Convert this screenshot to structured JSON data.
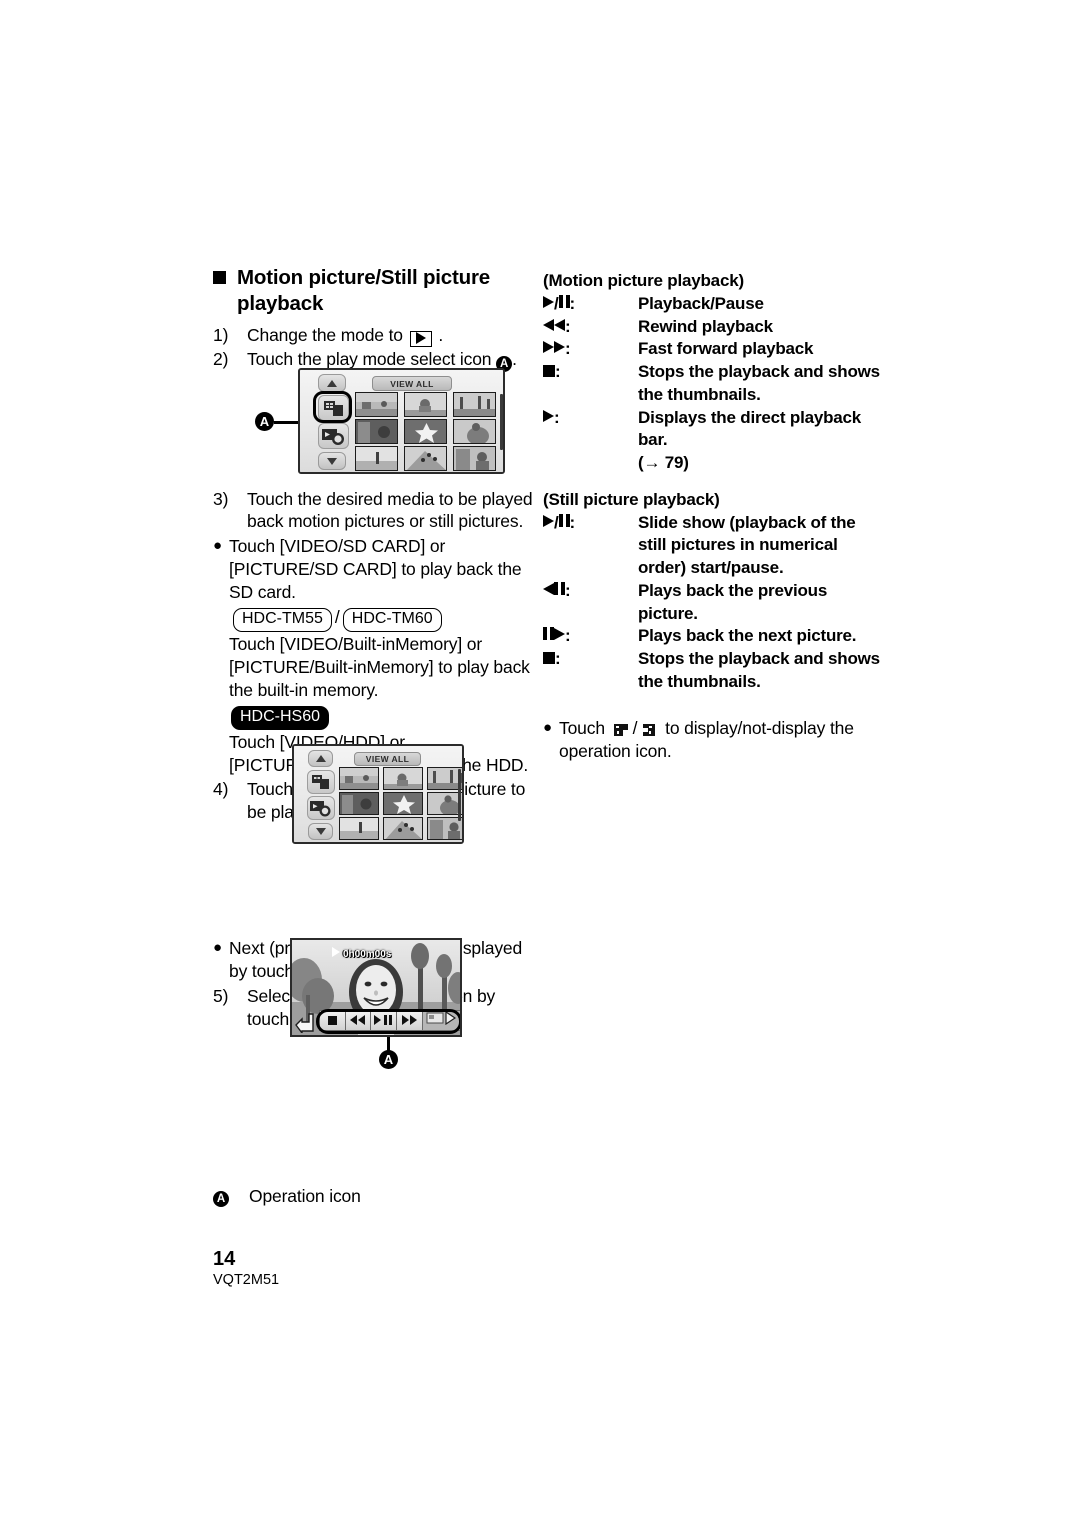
{
  "page": {
    "number": "14",
    "doc_id": "VQT2M51"
  },
  "left_column": {
    "heading": "Motion picture/Still picture playback",
    "steps": [
      {
        "num": "1)",
        "text_before": "Change the mode to",
        "icon": "play-mode-icon",
        "text_after": "."
      },
      {
        "num": "2)",
        "text_before": "Touch the play mode select icon",
        "marker": "A",
        "text_after": "."
      },
      {
        "num": "3)",
        "text": "Touch the desired media to be played back motion pictures or still pictures."
      },
      {
        "num": "4)",
        "text": "Touch the scene or the still picture to be played back."
      },
      {
        "num": "5)",
        "text": "Select the playback operation by touching the operation icon."
      }
    ],
    "bullet_sd": "Touch [VIDEO/SD CARD] or [PICTURE/SD CARD] to play back the SD card.",
    "badges_tm": [
      "HDC-TM55",
      "HDC-TM60"
    ],
    "badge_separator": "/",
    "text_tm": "Touch [VIDEO/Built-inMemory] or [PICTURE/Built-inMemory] to play back the built-in memory.",
    "badge_hs": "HDC-HS60",
    "text_hs": "Touch [VIDEO/HDD] or [PICTURE/HDD] to play back the HDD.",
    "bullet_page_before": "Next (previous) page can be displayed by touching",
    "bullet_page_separator": "/",
    "bullet_page_after": ".",
    "caption_marker": "A",
    "caption_text": "Operation icon"
  },
  "illustration_1": {
    "name": "thumbnail-screen-with-play-mode-select",
    "view_all_label": "VIEW ALL",
    "callout": "A",
    "icons": [
      "scroll-up-icon",
      "media-select-icon",
      "play-mode-select-icon",
      "scroll-down-icon"
    ],
    "thumbnail_count": 9
  },
  "illustration_2": {
    "name": "thumbnail-screen",
    "view_all_label": "VIEW ALL",
    "icons": [
      "scroll-up-icon",
      "media-select-icon",
      "play-mode-select-icon",
      "scroll-down-icon"
    ],
    "thumbnail_count": 9
  },
  "illustration_3": {
    "name": "motion-picture-playback-screen",
    "timecode": "0h00m00s",
    "callout": "A",
    "operation_buttons": [
      "stop-icon",
      "rewind-icon",
      "play-pause-icon",
      "fast-forward-icon",
      "direct-playback-bar-icon"
    ],
    "return_icon": "return-icon"
  },
  "right_column": {
    "motion_title": "(Motion picture playback)",
    "motion_rows": [
      {
        "key": "play-pause-icon",
        "key_text": "▶/▐▐:",
        "value": "Playback/Pause"
      },
      {
        "key": "rewind-icon",
        "key_text": "◀◀:",
        "value": "Rewind playback"
      },
      {
        "key": "fast-forward-icon",
        "key_text": "▶▶:",
        "value": "Fast forward playback"
      },
      {
        "key": "stop-icon",
        "key_text": "■:",
        "value": "Stops the playback and shows the thumbnails."
      },
      {
        "key": "direct-bar-icon",
        "key_text": "▶:",
        "value": "Displays the direct playback bar.",
        "ref": "(→ 79)"
      }
    ],
    "still_title": "(Still picture playback)",
    "still_rows": [
      {
        "key": "slideshow-play-pause-icon",
        "key_text": "▶/▐▐:",
        "value": "Slide show (playback of the still pictures in numerical order) start/pause."
      },
      {
        "key": "previous-picture-icon",
        "key_text": "◀▐▐:",
        "value": "Plays back the previous picture."
      },
      {
        "key": "next-picture-icon",
        "key_text": "▐▐▶:",
        "value": "Plays back the next picture."
      },
      {
        "key": "stop-icon",
        "key_text": "■:",
        "value": "Stops the playback and shows the thumbnails."
      }
    ],
    "note_before": "Touch",
    "note_icon_1": "show-operation-icon",
    "note_separator": "/",
    "note_icon_2": "hide-operation-icon",
    "note_after": "to display/not-display the operation icon."
  },
  "colors": {
    "text": "#000000",
    "badge_fill": "#000000",
    "lcd_border": "#2b2b2b"
  }
}
